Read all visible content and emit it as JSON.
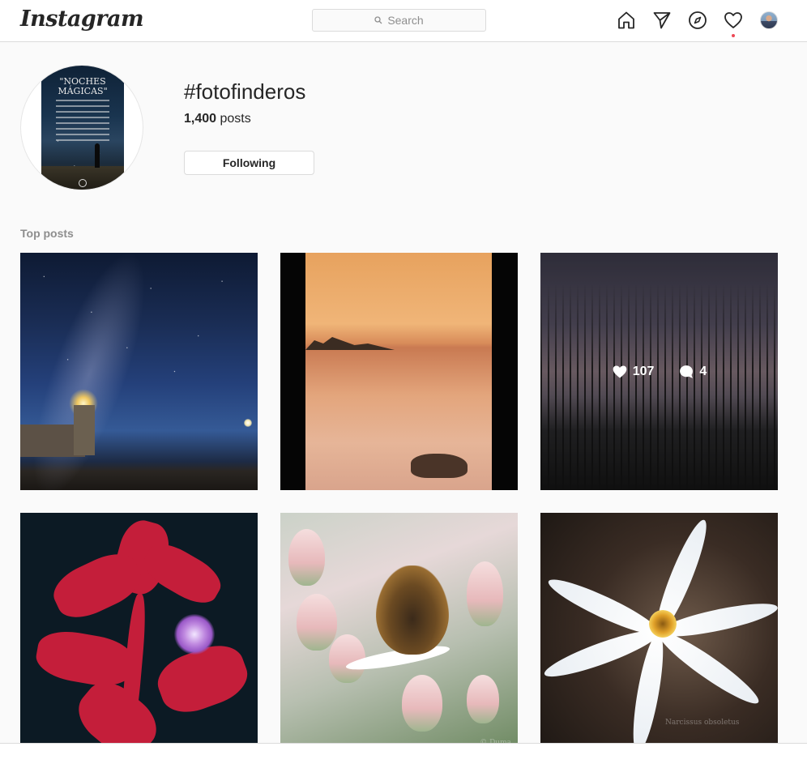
{
  "app": {
    "logo_text": "Instagram"
  },
  "search": {
    "placeholder": "Search"
  },
  "nav": {
    "icons": [
      "home-icon",
      "direct-icon",
      "explore-icon",
      "activity-icon",
      "profile-avatar"
    ],
    "notification_color": "#ed4956"
  },
  "hashtag": {
    "title": "#fotofinderos",
    "post_count": "1,400",
    "post_count_suffix": "posts",
    "follow_button": "Following",
    "poster_title": "\"NOCHES MÁGICAS\""
  },
  "top_posts": {
    "label": "Top posts",
    "items": [
      {
        "id": "post-lighthouse-night"
      },
      {
        "id": "post-sunset-lake"
      },
      {
        "id": "post-reeds-dusk",
        "likes": "107",
        "comments": "4"
      },
      {
        "id": "post-red-geranium"
      },
      {
        "id": "post-bee-flower"
      },
      {
        "id": "post-white-narcissus",
        "watermark": "Narcissus obsoletus"
      }
    ]
  },
  "colors": {
    "accent": "#262626",
    "muted": "#8e8e8e",
    "border": "#dbdbdb",
    "background": "#fafafa"
  }
}
